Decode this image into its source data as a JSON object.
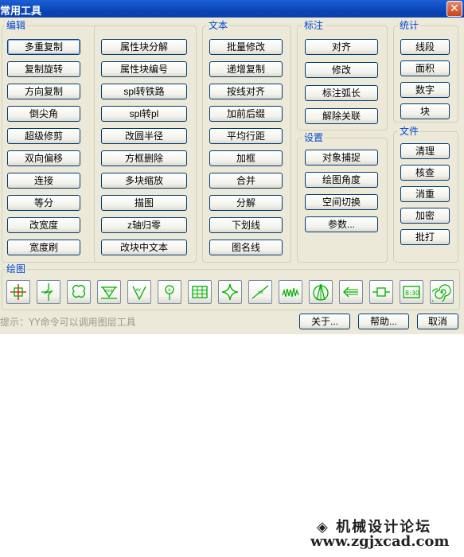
{
  "window": {
    "title": "常用工具",
    "close_glyph": "✕"
  },
  "groups": {
    "edit": {
      "label": "编辑",
      "buttons_col1": [
        "多重复制",
        "复制旋转",
        "方向复制",
        "倒尖角",
        "超级修剪",
        "双向偏移",
        "连接",
        "等分",
        "改宽度",
        "宽度刷"
      ],
      "buttons_col2": [
        "属性块分解",
        "属性块编号",
        "spl转铁路",
        "spl转pl",
        "改圆半径",
        "方框删除",
        "多块缩放",
        "描图",
        "z轴归零",
        "改块中文本"
      ]
    },
    "text": {
      "label": "文本",
      "buttons": [
        "批量修改",
        "递增复制",
        "按线对齐",
        "加前后缀",
        "平均行距",
        "加框",
        "合并",
        "分解",
        "下划线",
        "图名线"
      ]
    },
    "dim": {
      "label": "标注",
      "buttons": [
        "对齐",
        "修改",
        "标注弧长",
        "解除关联"
      ]
    },
    "settings": {
      "label": "设置",
      "buttons": [
        "对象捕捉",
        "绘图角度",
        "空间切换",
        "参数..."
      ]
    },
    "stats": {
      "label": "统计",
      "buttons": [
        "线段",
        "面积",
        "数字",
        "块"
      ]
    },
    "file": {
      "label": "文件",
      "buttons": [
        "清理",
        "核查",
        "消重",
        "加密",
        "批打"
      ]
    },
    "draw": {
      "label": "绘图",
      "tool_icons": [
        "crosshair-center-icon",
        "break-line-icon",
        "revision-cloud-icon",
        "ground-symbol-icon",
        "soil-hatch-icon",
        "pile-symbol-icon",
        "grid-table-icon",
        "star-shape-icon",
        "slope-line-icon",
        "zigzag-line-icon",
        "north-arrow-icon",
        "arrow-left-icon",
        "dimension-box-icon",
        "digital-display-icon",
        "spiral-icon"
      ]
    }
  },
  "footer": {
    "tip": "提示：YY命令可以调用图层工具",
    "about": "关于...",
    "help": "帮助...",
    "cancel": "取消"
  },
  "watermark": {
    "site_cn": "机械设计论坛",
    "url": "www.zgjxcad.com"
  },
  "colors": {
    "title_bar": "#0a46b8",
    "group_label": "#0046d5",
    "dialog_bg": "#ece9d8",
    "icon_green": "#00b000"
  }
}
